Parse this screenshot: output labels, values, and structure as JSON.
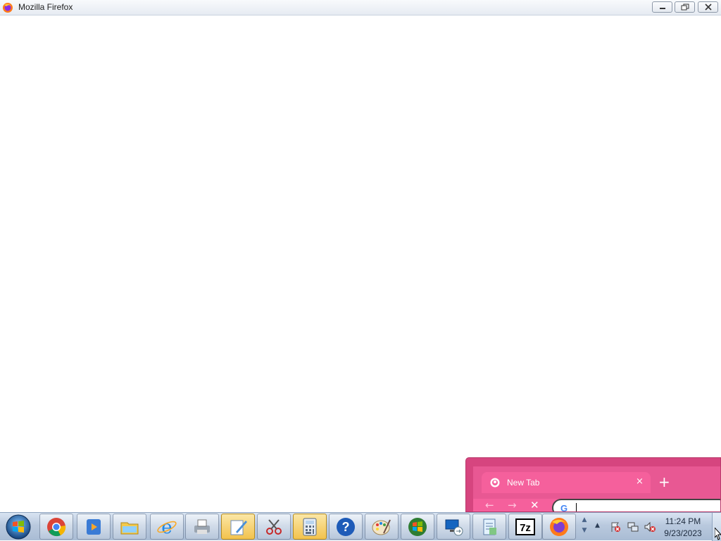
{
  "firefox_window": {
    "title": "Mozilla Firefox",
    "icon": "firefox-icon",
    "controls": {
      "minimize": "minimize-icon",
      "maximize": "restore-icon",
      "close": "close-icon"
    }
  },
  "chrome_window": {
    "tab_title": "New Tab",
    "tab_close": "×",
    "new_tab": "+",
    "nav": {
      "back": "←",
      "forward": "→",
      "stop": "✕"
    },
    "omnibox_icon": "G",
    "theme_color": "#f5609c"
  },
  "taskbar": {
    "start": "start-orb-icon",
    "buttons": [
      {
        "name": "chrome",
        "icon": "chrome-icon"
      },
      {
        "name": "media-player",
        "icon": "media-player-icon"
      },
      {
        "name": "explorer",
        "icon": "folder-icon"
      },
      {
        "name": "internet-explorer",
        "icon": "internet-explorer-icon"
      },
      {
        "name": "fax-scan",
        "icon": "printer-icon"
      },
      {
        "name": "editor",
        "icon": "notepad-pen-icon",
        "active": true
      },
      {
        "name": "snipping-tool",
        "icon": "scissors-icon"
      },
      {
        "name": "calculator",
        "icon": "calculator-icon",
        "active": true
      },
      {
        "name": "help",
        "icon": "help-icon"
      },
      {
        "name": "paint",
        "icon": "paint-palette-icon"
      },
      {
        "name": "windows-live",
        "icon": "windows-flag-icon"
      },
      {
        "name": "remote-desktop",
        "icon": "remote-desktop-icon"
      },
      {
        "name": "file-viewer",
        "icon": "document-icon"
      },
      {
        "name": "7zip",
        "icon": "7zip-icon",
        "label": "7z"
      },
      {
        "name": "firefox",
        "icon": "firefox-icon"
      }
    ],
    "tray": {
      "show_hidden": "▲",
      "icons": [
        "action-center-flag-icon",
        "network-icon",
        "volume-muted-icon"
      ],
      "time": "11:24 PM",
      "date": "9/23/2023"
    }
  }
}
